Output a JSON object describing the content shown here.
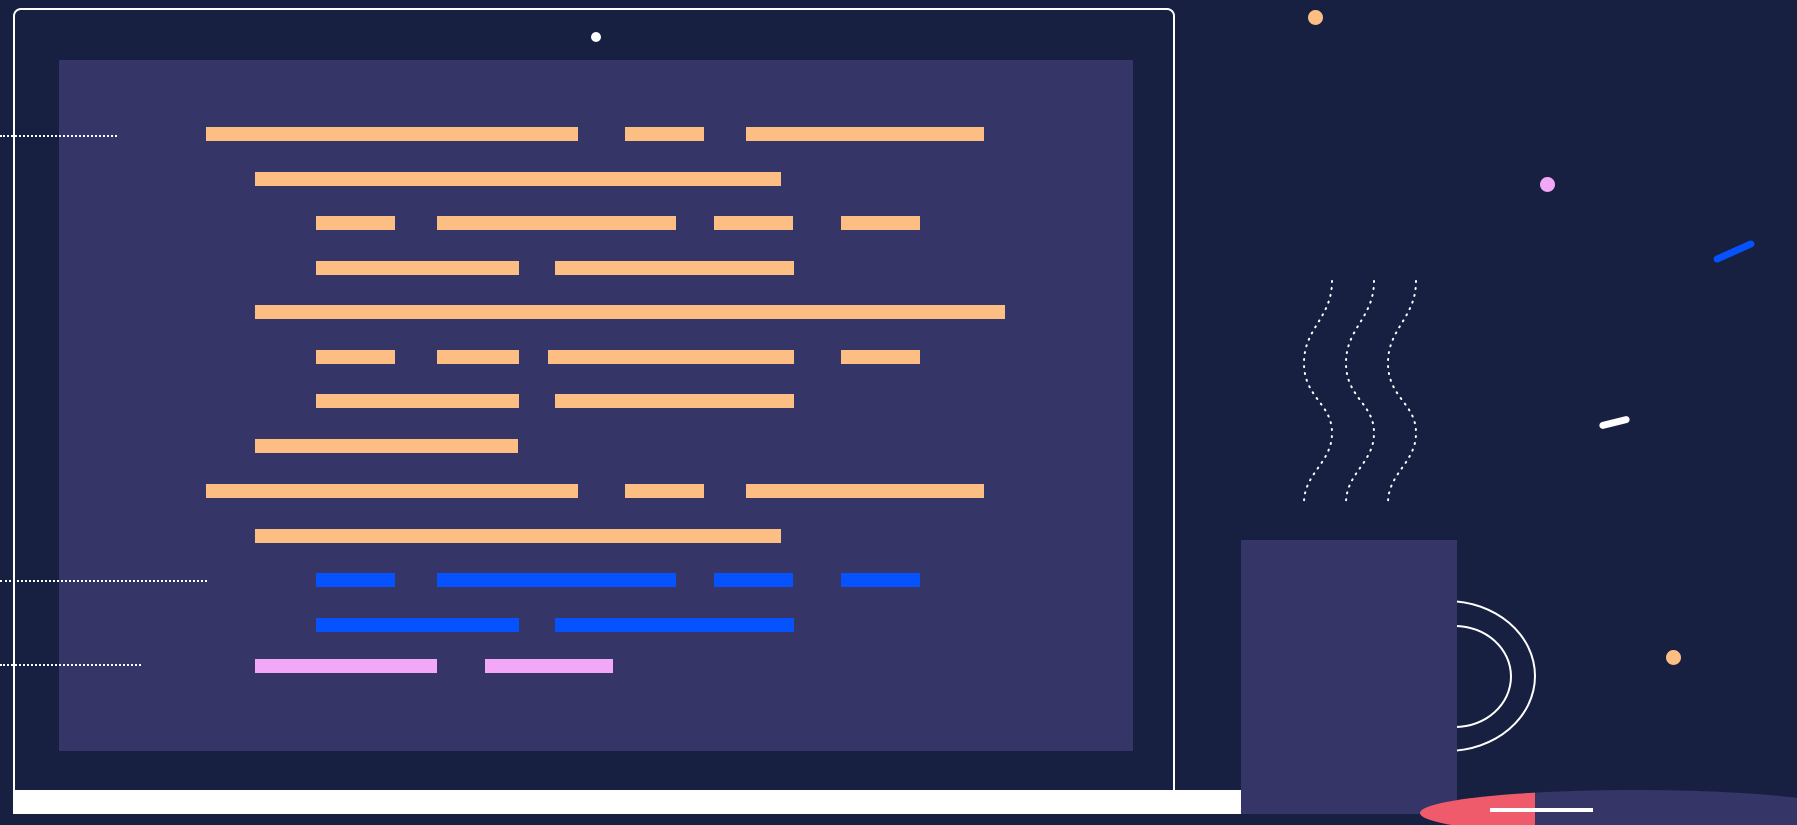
{
  "scene": {
    "background": "#182042",
    "description_colors": {
      "frame": "#ffffff",
      "screen": "#353568",
      "code_primary": "#fdbe84",
      "code_accent_blue": "#0652ff",
      "code_accent_pink": "#f2a8f7",
      "mug": "#353568",
      "saucer_red": "#ef5b6b"
    }
  },
  "laptop": {
    "icons": [
      "camera-dot-icon"
    ]
  },
  "code_editor": {
    "lines": [
      {
        "color": "#fdbe84",
        "segments": 3
      },
      {
        "color": "#fdbe84",
        "segments": 1
      },
      {
        "color": "#fdbe84",
        "segments": 4
      },
      {
        "color": "#fdbe84",
        "segments": 2
      },
      {
        "color": "#fdbe84",
        "segments": 1
      },
      {
        "color": "#fdbe84",
        "segments": 4
      },
      {
        "color": "#fdbe84",
        "segments": 2
      },
      {
        "color": "#fdbe84",
        "segments": 1
      },
      {
        "color": "#fdbe84",
        "segments": 3
      },
      {
        "color": "#fdbe84",
        "segments": 1
      },
      {
        "color": "#0652ff",
        "segments": 4
      },
      {
        "color": "#0652ff",
        "segments": 2
      },
      {
        "color": "#f2a8f7",
        "segments": 2
      }
    ]
  },
  "decorations": {
    "icons": [
      "steam-wave-icon",
      "coffee-mug-icon",
      "saucer-icon",
      "confetti-dot-icon",
      "confetti-dash-icon"
    ],
    "colors": {
      "orange_dot": "#fdbe84",
      "pink_dot": "#f2a8f7",
      "blue_dash": "#0652ff",
      "white_dash": "#ffffff"
    }
  }
}
